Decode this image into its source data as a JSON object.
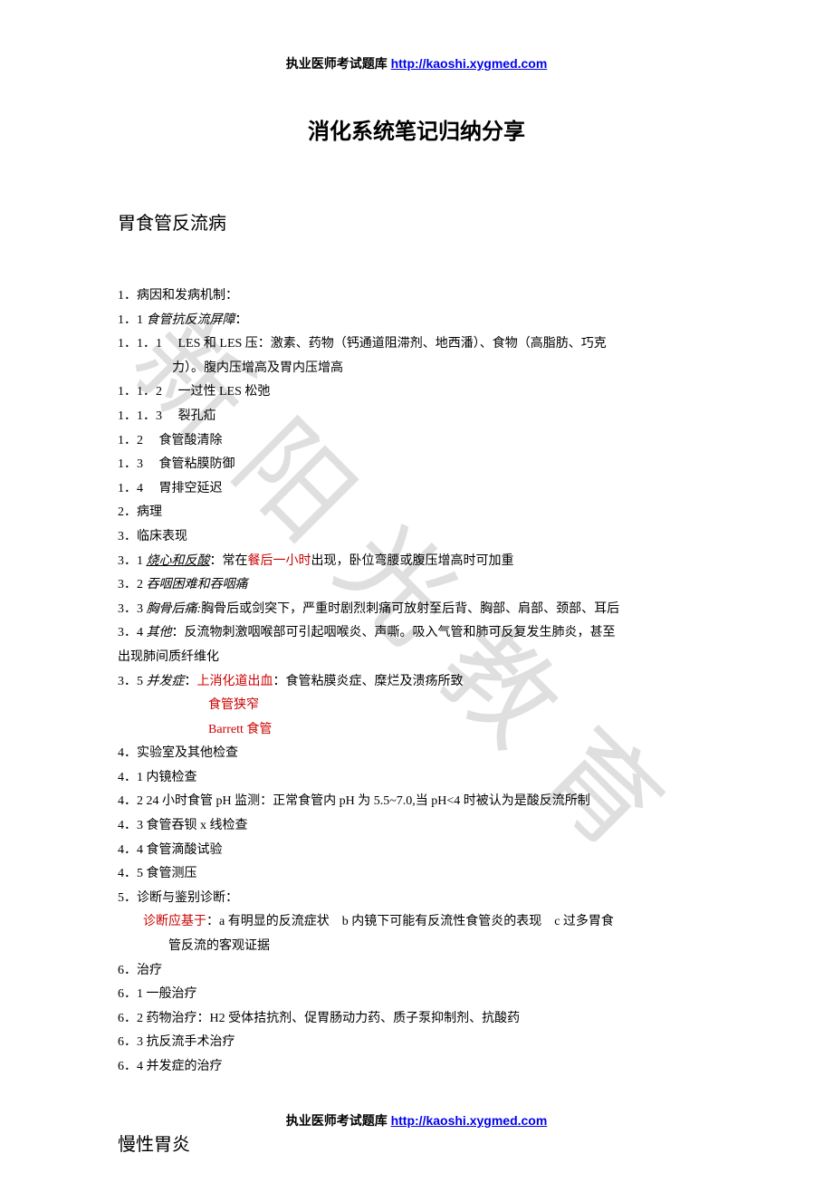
{
  "header": {
    "text": "执业医师考试题库 ",
    "link": "http://kaoshi.xygmed.com"
  },
  "title": "消化系统笔记归纳分享",
  "section1": {
    "heading": "胃食管反流病",
    "l1": "1．病因和发病机制：",
    "l2_pre": "1．1 ",
    "l2_em": "食管抗反流屏障",
    "l2_post": "：",
    "l3": "1．1．1　 LES 和 LES 压：激素、药物（钙通道阻滞剂、地西潘）、食物（高脂肪、巧克",
    "l3b": "力）。腹内压增高及胃内压增高",
    "l4": "1．1．2　 一过性 LES 松弛",
    "l5": "1．1．3　 裂孔疝",
    "l6": "1．2　 食管酸清除",
    "l7": "1．3　 食管粘膜防御",
    "l8": "1．4　 胃排空延迟",
    "l9": "2．病理",
    "l10": "3．临床表现",
    "l11_pre": "3．1 ",
    "l11_em": "烧心和反酸",
    "l11_mid": "：常在",
    "l11_red": "餐后一小时",
    "l11_post": "出现，卧位弯腰或腹压增高时可加重",
    "l12_pre": "3．2 ",
    "l12_em": "吞咽困难和吞咽痛",
    "l13_pre": "3．3 ",
    "l13_em": "胸骨后痛:",
    "l13_post": "胸骨后或剑突下，严重时剧烈刺痛可放射至后背、胸部、肩部、颈部、耳后",
    "l14_pre": "3．4 ",
    "l14_em": "其他",
    "l14_post": "：反流物刺激咽喉部可引起咽喉炎、声嘶。吸入气管和肺可反复发生肺炎，甚至",
    "l14b": "出现肺间质纤维化",
    "l15_pre": "3．5 ",
    "l15_em": "并发症",
    "l15_mid": "：",
    "l15_red": "上消化道出血",
    "l15_post": "：食管粘膜炎症、糜烂及溃疡所致",
    "l16_red": "食管狭窄",
    "l17_red": "Barrett 食管",
    "l18": "4．实验室及其他检查",
    "l19": "4．1 内镜检查",
    "l20": "4．2 24 小时食管 pH 监测：正常食管内 pH 为 5.5~7.0,当 pH<4 时被认为是酸反流所制",
    "l21": "4．3 食管吞钡 x 线检查",
    "l22": "4．4 食管滴酸试验",
    "l23": "4．5 食管测压",
    "l24": "5．诊断与鉴别诊断：",
    "l25_red": "诊断应基于",
    "l25_post": "：a 有明显的反流症状　b 内镜下可能有反流性食管炎的表现　c 过多胃食",
    "l25b": "管反流的客观证据",
    "l26": "6．治疗",
    "l27": "6．1 一般治疗",
    "l28": "6．2 药物治疗：H2 受体拮抗剂、促胃肠动力药、质子泵抑制剂、抗酸药",
    "l29": "6．3 抗反流手术治疗",
    "l30": "6．4 并发症的治疗"
  },
  "section2": {
    "heading": "慢性胃炎"
  },
  "watermark": "新阳光教育",
  "footer": {
    "text": "执业医师考试题库 ",
    "link": "http://kaoshi.xygmed.com"
  }
}
